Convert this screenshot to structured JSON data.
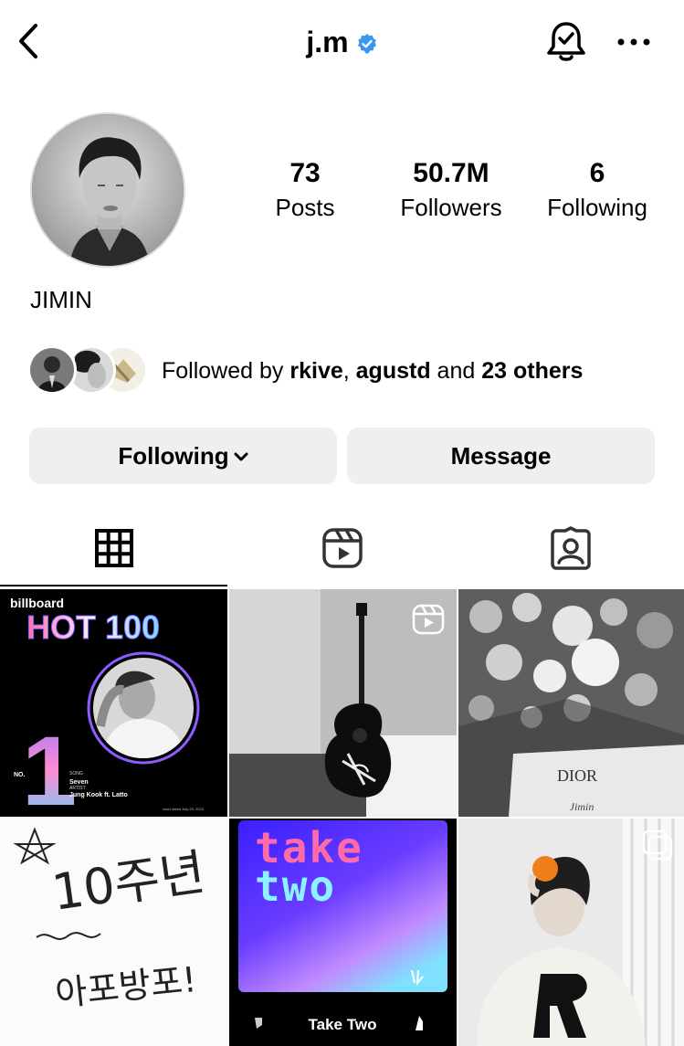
{
  "header": {
    "username": "j.m",
    "verified": true,
    "back_icon": "chevron-left-icon",
    "bell_icon": "notification-bell-check-icon",
    "more_icon": "more-horizontal-icon"
  },
  "profile": {
    "display_name": "JIMIN",
    "stats": [
      {
        "value": "73",
        "label": "Posts"
      },
      {
        "value": "50.7M",
        "label": "Followers"
      },
      {
        "value": "6",
        "label": "Following"
      }
    ],
    "followed_by": {
      "prefix": "Followed by ",
      "user1": "rkive",
      "sep": ", ",
      "user2": "agustd",
      "middle": " and ",
      "others": "23 others"
    }
  },
  "actions": {
    "following_label": "Following",
    "message_label": "Message"
  },
  "tabs": [
    {
      "icon": "grid-icon",
      "active": true
    },
    {
      "icon": "reels-icon",
      "active": false
    },
    {
      "icon": "tagged-icon",
      "active": false
    }
  ],
  "posts": {
    "p1": {
      "brand": "billboard",
      "chart": "HOT 100",
      "rank_prefix": "NO.",
      "rank": "1",
      "song_label": "SONG",
      "song": "Seven",
      "artist_label": "ARTIST",
      "artist": "Jung Kook ft. Latto",
      "dated": "chart dated July 29, 2023"
    },
    "p3": {
      "brand": "DIOR",
      "signature": "Jimin"
    },
    "p4": {
      "line1": "10주년",
      "line2": "아포방포!"
    },
    "p5": {
      "title_top": "take",
      "title_bottom": "two",
      "footer": "Take Two"
    }
  },
  "colors": {
    "verified": "#3897f0",
    "button_bg": "#efefef",
    "divider": "#dbdbdb"
  }
}
